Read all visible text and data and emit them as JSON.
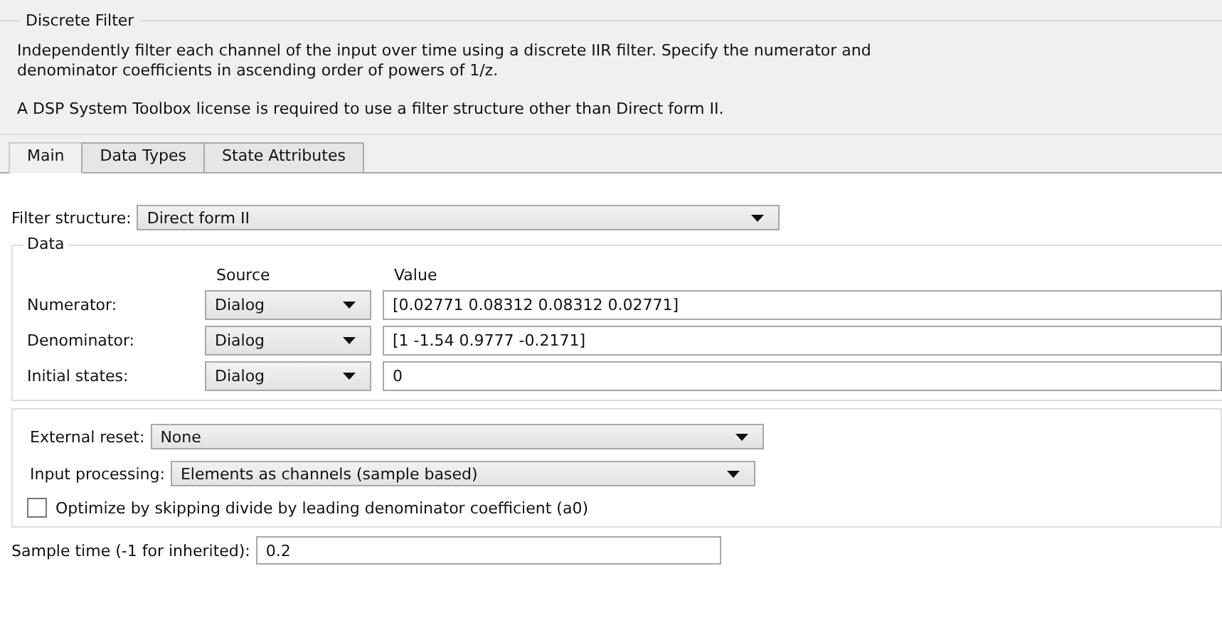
{
  "block": {
    "title": "Discrete Filter",
    "description": [
      "Independently filter each channel of the input over time using a discrete IIR filter. Specify the numerator and denominator coefficients in ascending order of powers of 1/z.",
      "A DSP System Toolbox license is required to use a filter structure other than Direct form II."
    ]
  },
  "tabs": [
    {
      "label": "Main",
      "selected": true
    },
    {
      "label": "Data Types",
      "selected": false
    },
    {
      "label": "State Attributes",
      "selected": false
    }
  ],
  "filter_structure": {
    "label": "Filter structure:",
    "value": "Direct form II"
  },
  "data": {
    "title": "Data",
    "columns": [
      "Source",
      "Value"
    ],
    "rows": [
      {
        "label": "Numerator:",
        "source": "Dialog",
        "value": "[0.02771 0.08312 0.08312 0.02771]"
      },
      {
        "label": "Denominator:",
        "source": "Dialog",
        "value": "[1 -1.54 0.9777 -0.2171]"
      },
      {
        "label": "Initial states:",
        "source": "Dialog",
        "value": "0"
      }
    ]
  },
  "options": [
    {
      "kind": "dropdown",
      "label": "External reset:",
      "value": "None"
    },
    {
      "kind": "dropdown",
      "label": "Input processing:",
      "value": "Elements as channels (sample based)"
    },
    {
      "kind": "checkbox",
      "label": "Optimize by skipping divide by leading denominator coefficient (a0)",
      "checked": false
    }
  ],
  "sample_time": {
    "label": "Sample time (-1 for inherited):",
    "value": "0.2"
  }
}
